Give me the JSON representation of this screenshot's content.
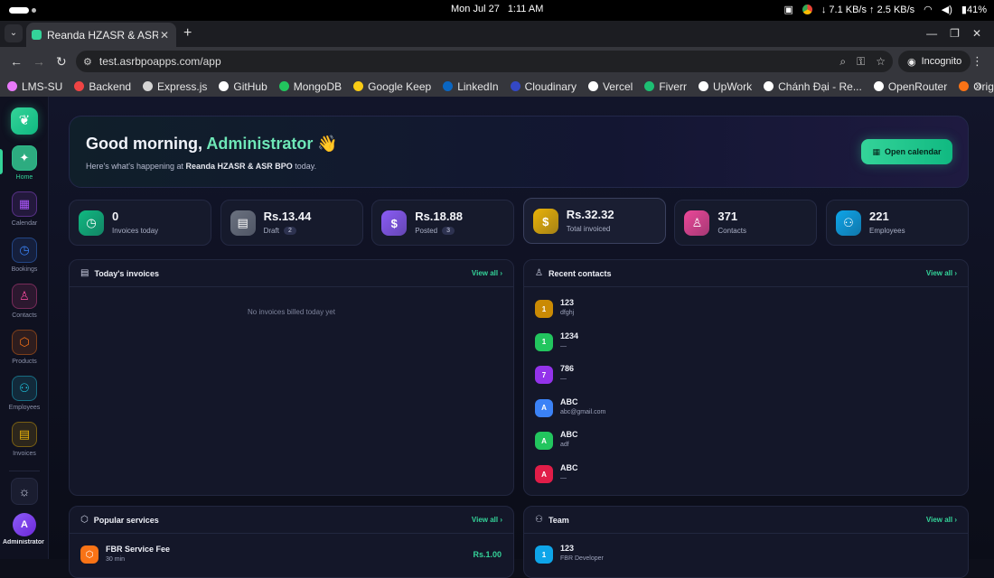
{
  "os": {
    "date": "Mon Jul 27",
    "time": "1:11 AM",
    "net_speed": "↓ 7.1 KB/s ↑ 2.5 KB/s",
    "battery": "41%"
  },
  "browser": {
    "tab_title": "Reanda HZASR & ASR BPO",
    "url": "test.asrbpoapps.com/app",
    "incognito_label": "Incognito",
    "bookmarks": [
      {
        "label": "LMS-SU",
        "color": "#e879f9"
      },
      {
        "label": "Backend",
        "color": "#ef4444"
      },
      {
        "label": "Express.js",
        "color": "#d4d4d4"
      },
      {
        "label": "GitHub",
        "color": "#ffffff"
      },
      {
        "label": "MongoDB",
        "color": "#22c55e"
      },
      {
        "label": "Google Keep",
        "color": "#facc15"
      },
      {
        "label": "LinkedIn",
        "color": "#0a66c2"
      },
      {
        "label": "Cloudinary",
        "color": "#3448c5"
      },
      {
        "label": "Vercel",
        "color": "#ffffff"
      },
      {
        "label": "Fiverr",
        "color": "#1dbf73"
      },
      {
        "label": "UpWork",
        "color": "#ffffff"
      },
      {
        "label": "Chánh Đại - Re...",
        "color": "#ffffff"
      },
      {
        "label": "OpenRouter",
        "color": "#ffffff"
      },
      {
        "label": "Origin kit",
        "color": "#f97316"
      }
    ]
  },
  "sidebar": {
    "items": [
      {
        "label": "Home",
        "icon": "sparkle-icon",
        "glyph": "✦",
        "color": "#34d399"
      },
      {
        "label": "Calendar",
        "icon": "calendar-icon",
        "glyph": "▦",
        "color": "#a855f7"
      },
      {
        "label": "Bookings",
        "icon": "clock-icon",
        "glyph": "◷",
        "color": "#3b82f6"
      },
      {
        "label": "Contacts",
        "icon": "user-icon",
        "glyph": "♙",
        "color": "#ec4899"
      },
      {
        "label": "Products",
        "icon": "box-icon",
        "glyph": "⬡",
        "color": "#f97316"
      },
      {
        "label": "Employees",
        "icon": "users-icon",
        "glyph": "⚇",
        "color": "#22d3ee"
      },
      {
        "label": "Invoices",
        "icon": "document-icon",
        "glyph": "▤",
        "color": "#eab308"
      }
    ],
    "avatar_initial": "A",
    "avatar_name": "Administrator"
  },
  "hero": {
    "greeting": "Good morning,",
    "name": "Administrator",
    "wave": "👋",
    "sub_prefix": "Here's what's happening at",
    "company": "Reanda HZASR & ASR BPO",
    "sub_suffix": "today.",
    "calendar_button": "Open calendar"
  },
  "stats": [
    {
      "value": "0",
      "label": "Invoices today",
      "badge": "",
      "color": "#10b981",
      "icon": "clock-icon",
      "glyph": "◷"
    },
    {
      "value": "Rs.13.44",
      "label": "Draft",
      "badge": "2",
      "color": "#6b7280",
      "icon": "document-icon",
      "glyph": "▤"
    },
    {
      "value": "Rs.18.88",
      "label": "Posted",
      "badge": "3",
      "color": "#8b5cf6",
      "icon": "dollar-icon",
      "glyph": "$"
    },
    {
      "value": "Rs.32.32",
      "label": "Total invoiced",
      "badge": "",
      "color": "#eab308",
      "icon": "dollar-icon",
      "glyph": "$"
    },
    {
      "value": "371",
      "label": "Contacts",
      "badge": "",
      "color": "#ec4899",
      "icon": "user-icon",
      "glyph": "♙"
    },
    {
      "value": "221",
      "label": "Employees",
      "badge": "",
      "color": "#0ea5e9",
      "icon": "users-icon",
      "glyph": "⚇"
    }
  ],
  "invoices_card": {
    "title": "Today's invoices",
    "view_all": "View all",
    "empty_text": "No invoices billed today yet"
  },
  "contacts_card": {
    "title": "Recent contacts",
    "view_all": "View all",
    "items": [
      {
        "initial": "1",
        "name": "123",
        "sub": "dfghj",
        "color": "#ca8a04"
      },
      {
        "initial": "1",
        "name": "1234",
        "sub": "—",
        "color": "#22c55e"
      },
      {
        "initial": "7",
        "name": "786",
        "sub": "—",
        "color": "#9333ea"
      },
      {
        "initial": "A",
        "name": "ABC",
        "sub": "abc@gmail.com",
        "color": "#3b82f6"
      },
      {
        "initial": "A",
        "name": "ABC",
        "sub": "adf",
        "color": "#22c55e"
      },
      {
        "initial": "A",
        "name": "ABC",
        "sub": "—",
        "color": "#e11d48"
      }
    ]
  },
  "services_card": {
    "title": "Popular services",
    "view_all": "View all",
    "items": [
      {
        "name": "FBR Service Fee",
        "sub": "30 min",
        "price": "Rs.1.00"
      }
    ]
  },
  "team_card": {
    "title": "Team",
    "view_all": "View all",
    "items": [
      {
        "initial": "1",
        "name": "123",
        "sub": "FBR Developer",
        "color": "#0ea5e9"
      }
    ]
  }
}
